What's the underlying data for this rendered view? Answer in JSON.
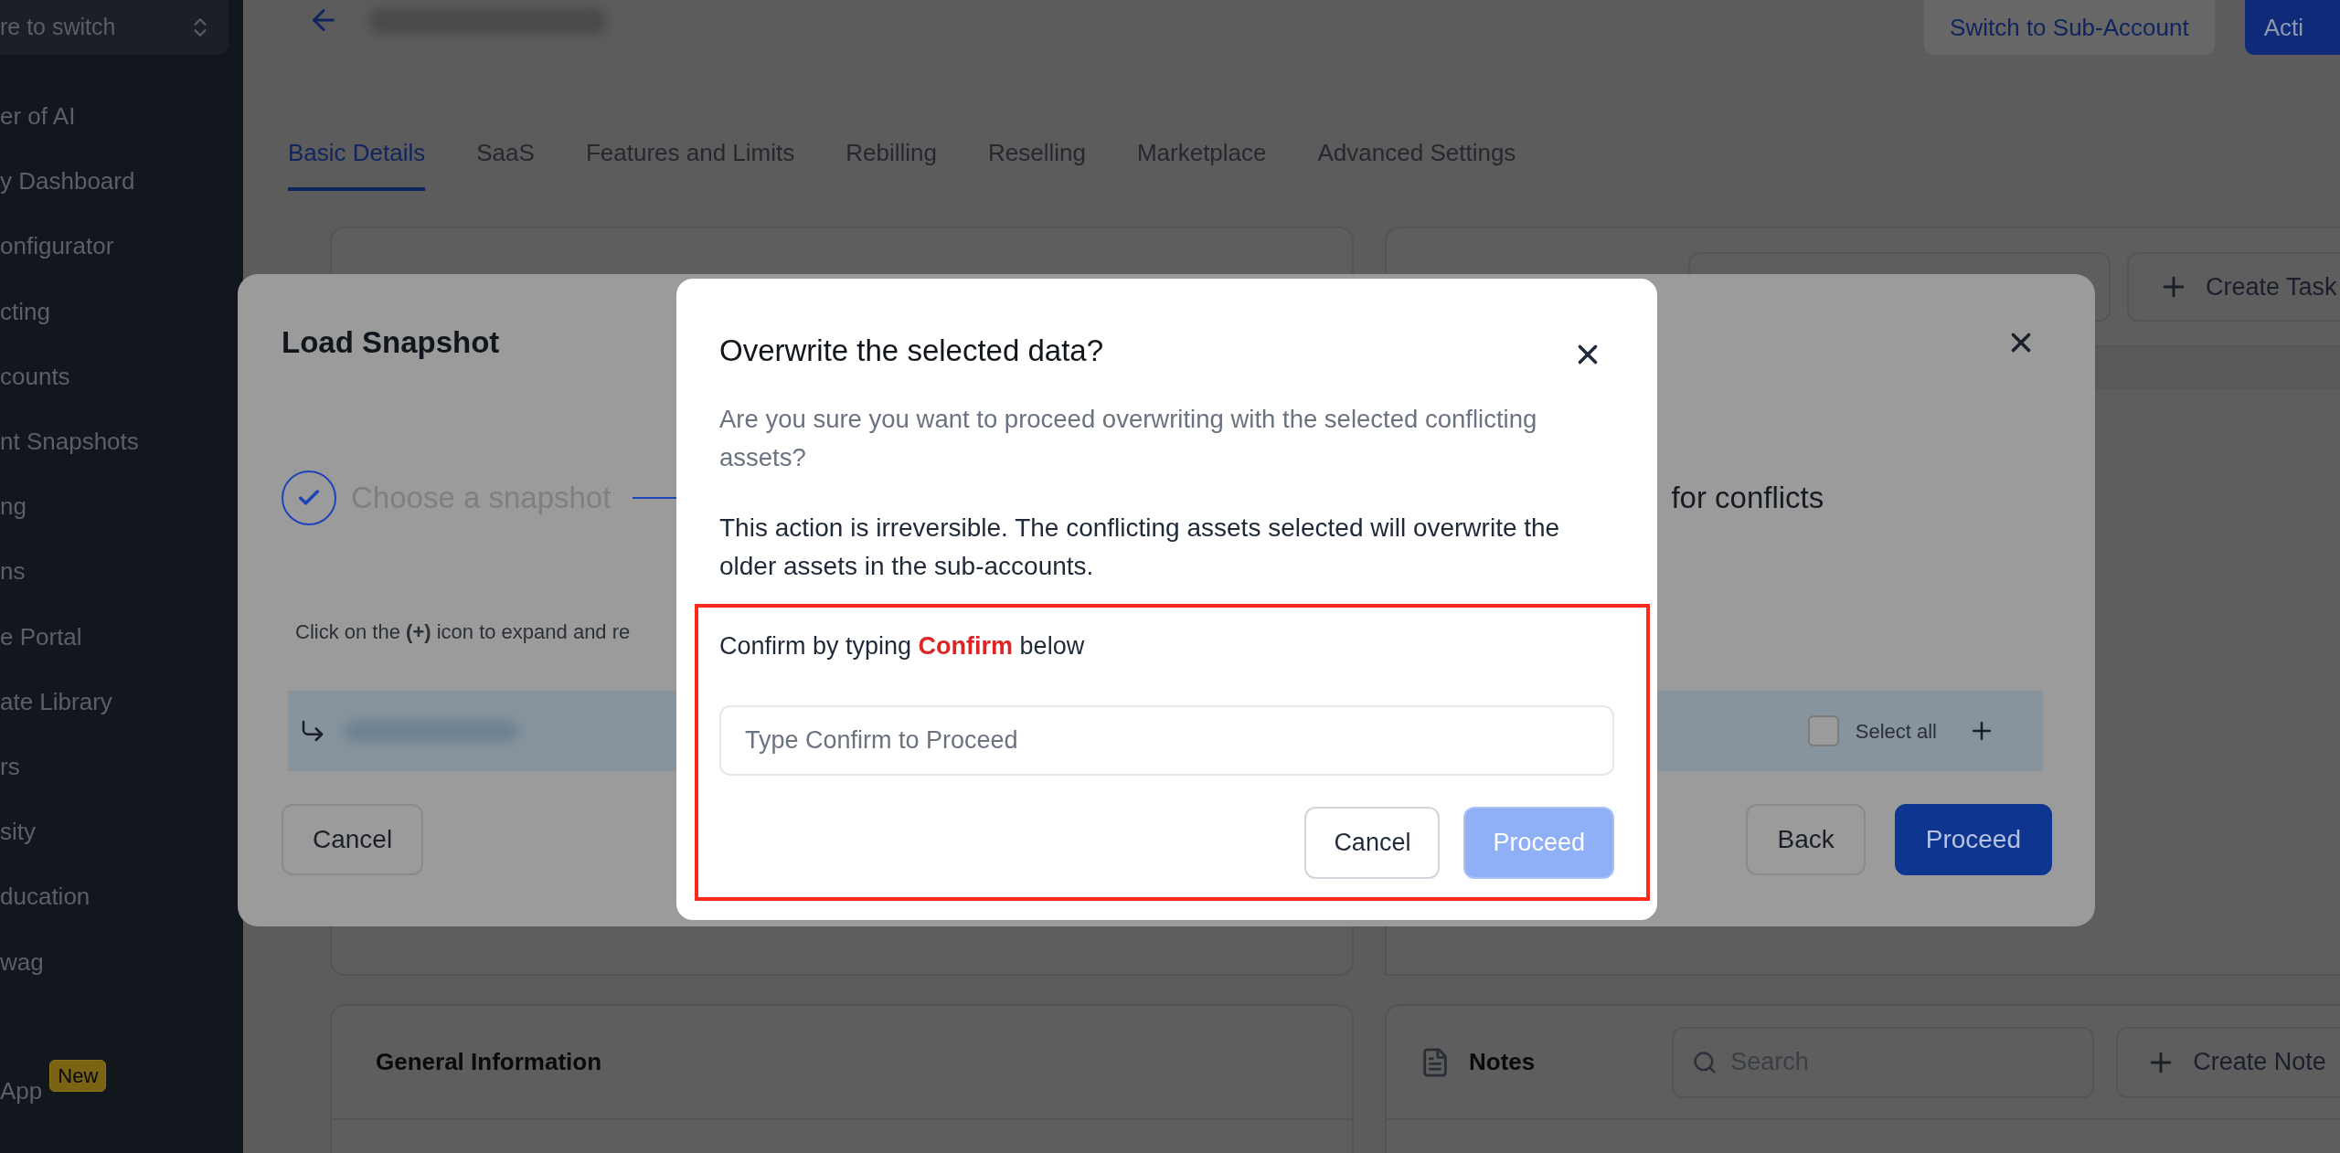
{
  "sidebar": {
    "switcher": {
      "label": "re to switch"
    },
    "items": [
      {
        "label": "er of AI"
      },
      {
        "label": "y Dashboard"
      },
      {
        "label": "onfigurator"
      },
      {
        "label": "cting"
      },
      {
        "label": "counts"
      },
      {
        "label": "nt Snapshots"
      },
      {
        "label": "ng"
      },
      {
        "label": "ns"
      },
      {
        "label": "e Portal"
      },
      {
        "label": "ate Library"
      },
      {
        "label": "rs"
      },
      {
        "label": "sity"
      },
      {
        "label": "ducation"
      },
      {
        "label": "wag"
      }
    ],
    "footer_item": {
      "label": "App",
      "badge": "New"
    }
  },
  "header": {
    "actions": [
      {
        "label": "Switch to Sub-Account",
        "kind": "secondary"
      },
      {
        "label": "Acti",
        "kind": "primary"
      }
    ]
  },
  "tabs": [
    {
      "label": "Basic Details",
      "selected": true
    },
    {
      "label": "SaaS",
      "selected": false
    },
    {
      "label": "Features and Limits",
      "selected": false
    },
    {
      "label": "Rebilling",
      "selected": false
    },
    {
      "label": "Reselling",
      "selected": false
    },
    {
      "label": "Marketplace",
      "selected": false
    },
    {
      "label": "Advanced Settings",
      "selected": false
    }
  ],
  "tasks_panel": {
    "button": "Create Task"
  },
  "general_information": {
    "title": "General Information"
  },
  "notes": {
    "title": "Notes",
    "search_placeholder": "Search",
    "button": "Create Note"
  },
  "load_snapshot": {
    "title": "Load Snapshot",
    "steps": [
      {
        "label": "Choose a snapshot",
        "done": true
      },
      {
        "label": "for conflicts",
        "done": false
      }
    ],
    "hint": "Click on the **(+)** icon to expand and re",
    "select_all": {
      "label": "Select all",
      "checked": false
    },
    "buttons": [
      {
        "label": "Cancel",
        "kind": "secondary"
      },
      {
        "label": "Back",
        "kind": "secondary"
      },
      {
        "label": "Proceed",
        "kind": "primary"
      }
    ]
  },
  "dialog": {
    "title": "Overwrite the selected data?",
    "question": "Are you sure you want to proceed overwriting with the selected conflicting assets?",
    "warning": "This action is irreversible. The conflicting assets selected will overwrite the older assets in the sub-accounts.",
    "confirm": {
      "highlighted": true,
      "prompt": "Confirm by typing **Confirm** below",
      "placeholder": "Type Confirm to Proceed"
    },
    "buttons": [
      {
        "label": "Cancel",
        "kind": "secondary",
        "disabled": false
      },
      {
        "label": "Proceed",
        "kind": "primary",
        "disabled": true
      }
    ]
  }
}
